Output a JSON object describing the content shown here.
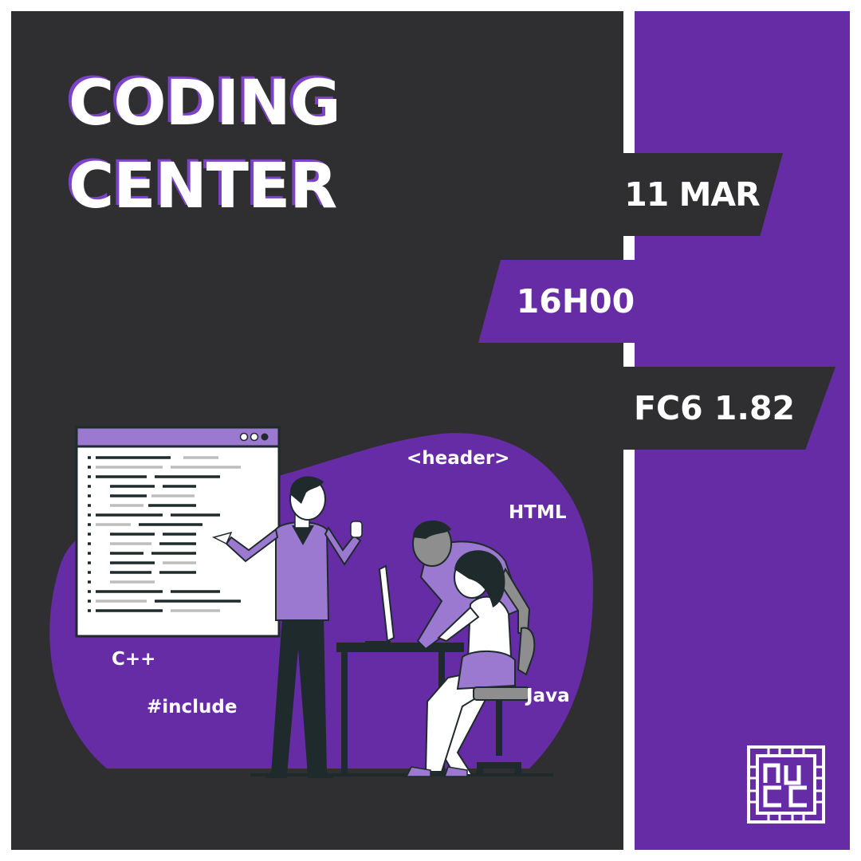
{
  "poster": {
    "title_line1": "CODING",
    "title_line2": "CENTER",
    "date": "11 MAR",
    "time": "16H00",
    "room": "FC6 1.82"
  },
  "code_words": {
    "header": "<header>",
    "html": "HTML",
    "cpp": "C++",
    "include": "#include",
    "java": "Java"
  },
  "colors": {
    "dark": "#2f2f31",
    "purple": "#652ca5",
    "light_purple": "#9b79d1",
    "white": "#ffffff"
  },
  "icons": [
    "code-window-icon",
    "window-dots-icon",
    "chip-logo-icon"
  ]
}
